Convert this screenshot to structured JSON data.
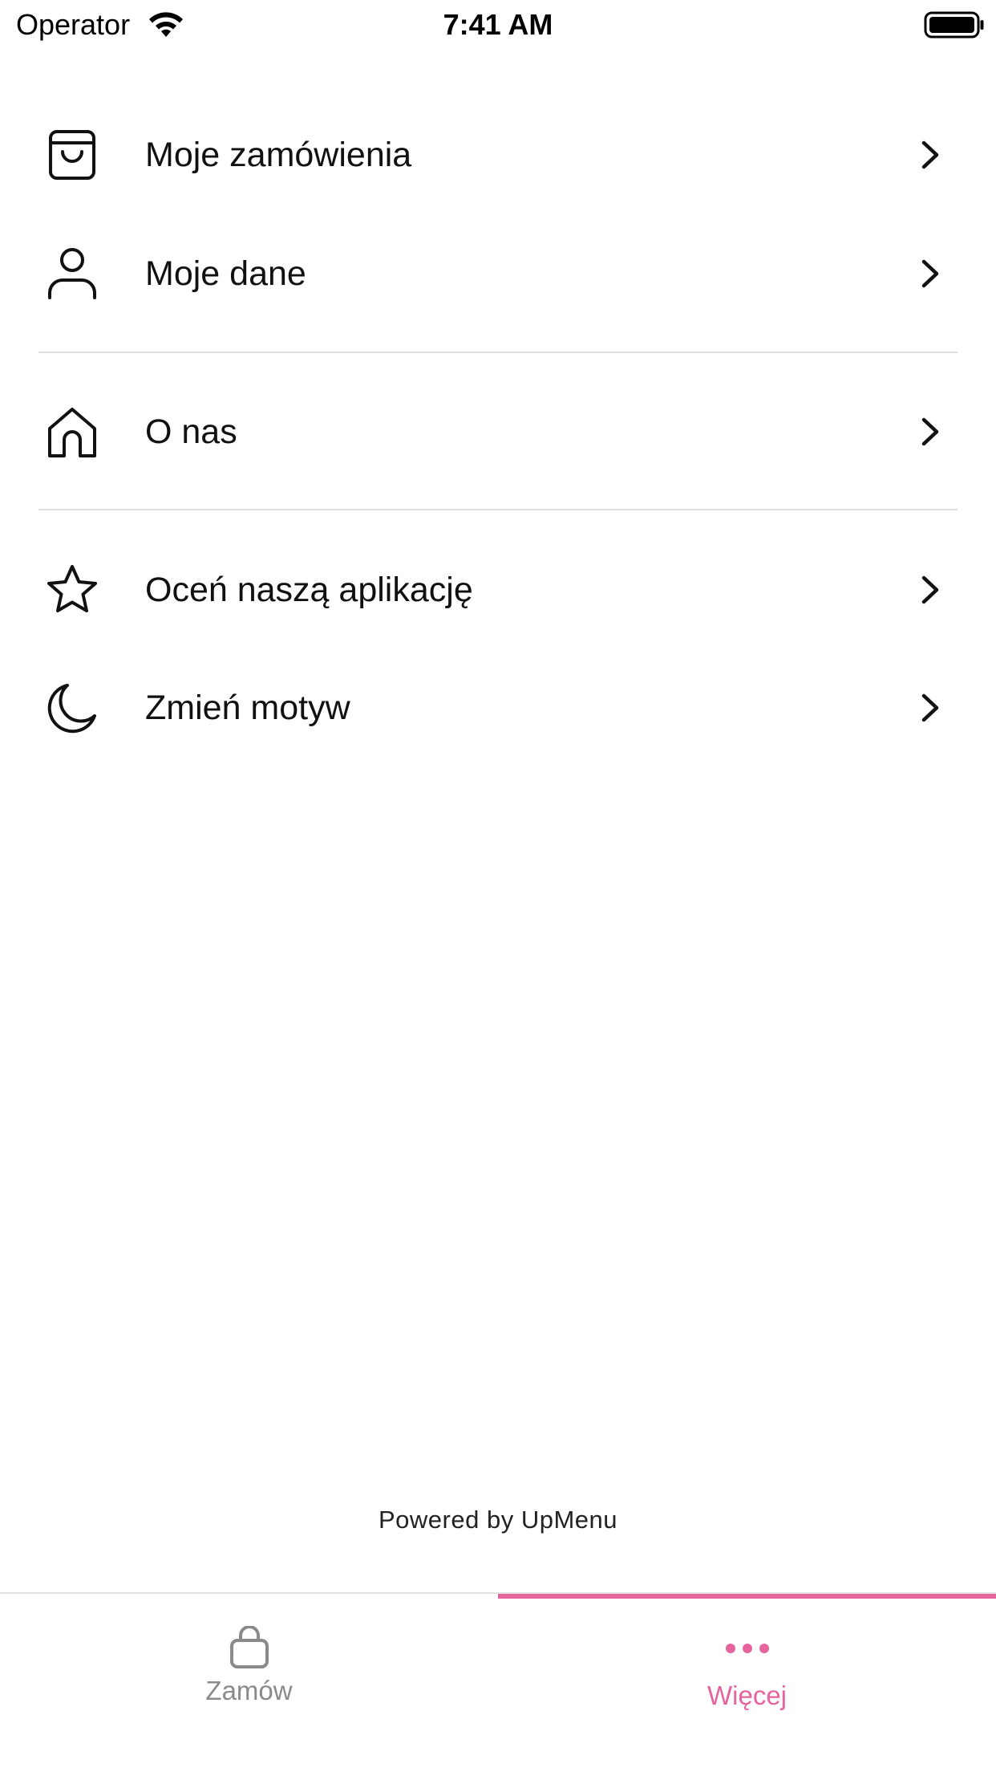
{
  "status_bar": {
    "carrier": "Operator",
    "time": "7:41 AM"
  },
  "menu": {
    "items": [
      {
        "label": "Moje zamówienia",
        "icon": "shopping-bag-icon"
      },
      {
        "label": "Moje dane",
        "icon": "user-icon"
      },
      {
        "label": "O nas",
        "icon": "home-icon"
      },
      {
        "label": "Oceń naszą aplikację",
        "icon": "star-icon"
      },
      {
        "label": "Zmień motyw",
        "icon": "moon-icon"
      }
    ]
  },
  "footer": {
    "powered_by": "Powered by UpMenu"
  },
  "tabbar": {
    "tabs": [
      {
        "label": "Zamów",
        "icon": "bag-icon",
        "active": false
      },
      {
        "label": "Więcej",
        "icon": "more-dots-icon",
        "active": true
      }
    ]
  },
  "colors": {
    "accent": "#e6649e",
    "inactive_tab": "#8a8a8a",
    "text": "#111111",
    "divider": "#dcdcdc"
  }
}
